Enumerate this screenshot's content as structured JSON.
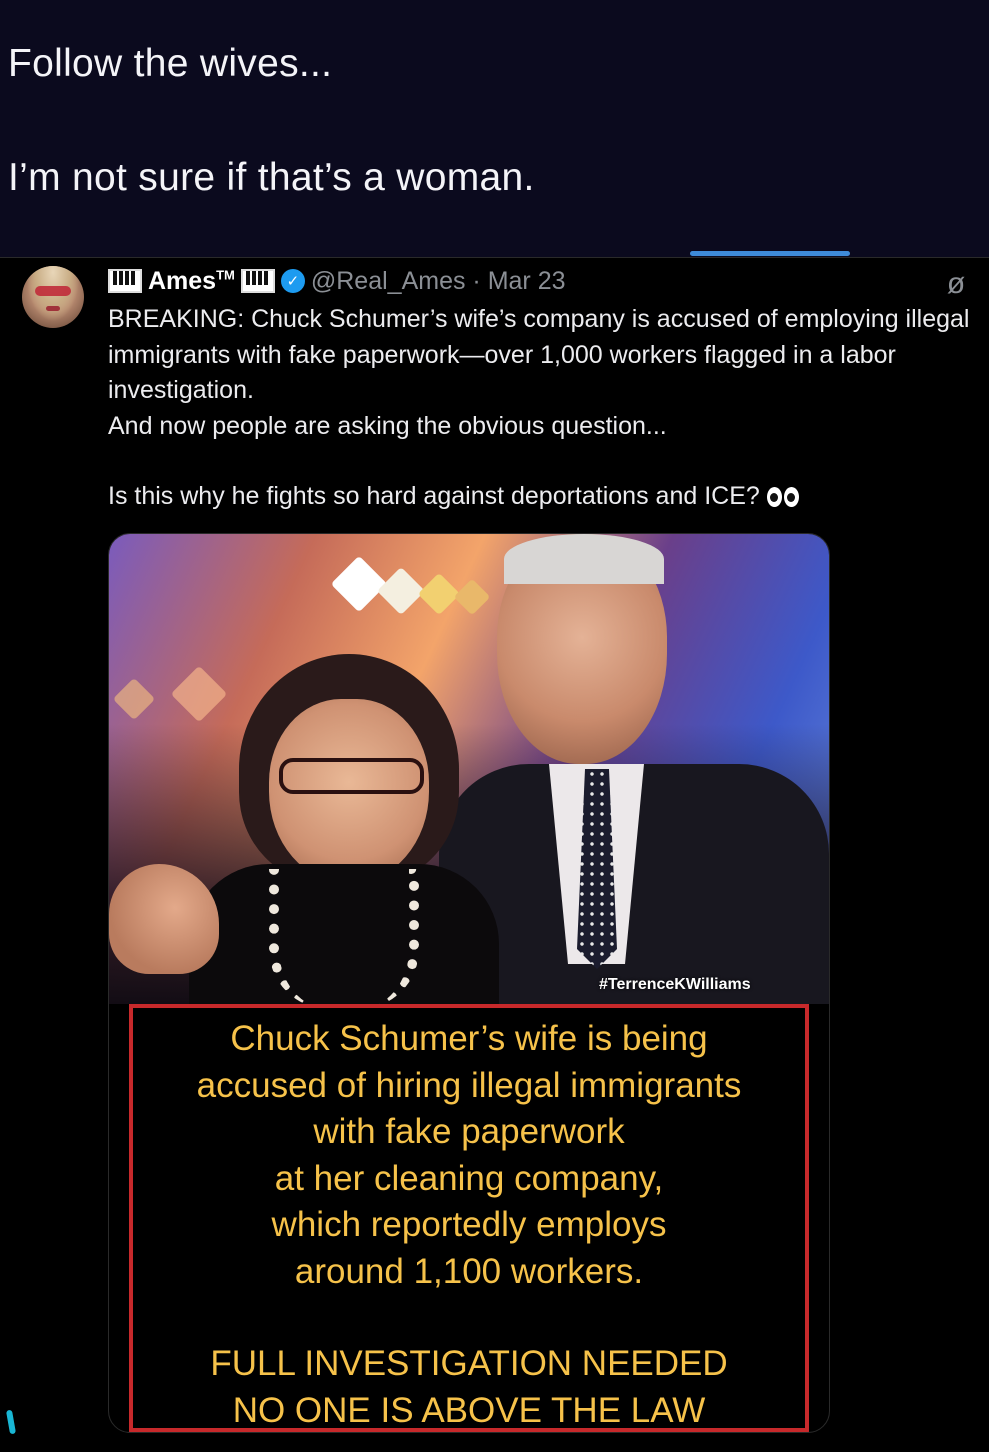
{
  "caption": {
    "line1": "Follow the wives...",
    "line2": "I’m not sure if that’s a woman."
  },
  "tweet": {
    "display_name": "Ames",
    "name_suffix": "TM",
    "verified_icon": "✓",
    "handle_time": "@Real_Ames · Mar 23",
    "body_main": "BREAKING: Chuck Schumer’s wife’s company is accused of employing illegal immigrants with fake paperwork—over 1,000 workers flagged in a labor investigation.\nAnd now people are asking the obvious question...",
    "body_question": "Is this why he fights so hard against deportations and ICE?",
    "icons": {
      "avatar": "avatar",
      "piano_emoji": "piano-keys-icon",
      "eyes_emoji": "eyes-icon",
      "grok_icon": "grok-icon"
    }
  },
  "media": {
    "watermark": "#TerrenceKWilliams",
    "banner_text": "Chuck Schumer’s wife is being\naccused of hiring illegal immigrants\nwith fake paperwork\nat her cleaning company,\nwhich reportedly  employs\naround 1,100 workers.",
    "banner_cta": "FULL INVESTIGATION NEEDED\nNO ONE IS ABOVE THE LAW",
    "colors": {
      "banner_text": "#f6c24a",
      "banner_border": "#c7292b"
    }
  },
  "colors": {
    "background": "#0b0a1e",
    "accent_blue": "#3e8bd9",
    "verified_blue": "#1d9bf0"
  }
}
